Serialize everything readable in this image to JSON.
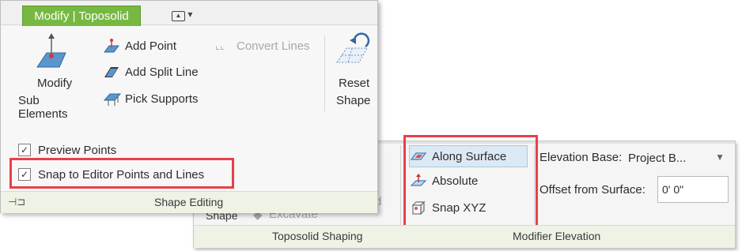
{
  "front_panel": {
    "context_tab": "Modify | Toposolid",
    "qat_toggle": "▾",
    "modify_sub_elements": [
      "Modify",
      "Sub Elements"
    ],
    "add_point": "Add Point",
    "add_split_line": "Add Split Line",
    "pick_supports": "Pick Supports",
    "convert_lines": "Convert Lines",
    "reset_shape": [
      "Reset",
      "Shape"
    ],
    "preview_points": {
      "label": "Preview Points",
      "checked": true
    },
    "snap_to_editor": {
      "label": "Snap to Editor Points and Lines",
      "checked": true
    },
    "panel_title": "Shape Editing",
    "pin_icon": "pin-icon"
  },
  "back_panel": {
    "modifier_items": [
      {
        "label": "Along Surface",
        "selected": true,
        "icon": "along-surface-icon"
      },
      {
        "label": "Absolute",
        "selected": false,
        "icon": "absolute-icon"
      },
      {
        "label": "Snap XYZ",
        "selected": false,
        "icon": "snap-xyz-icon"
      }
    ],
    "elevation_base_label": "Elevation Base:",
    "elevation_base_value": "Project B...",
    "offset_label": "Offset from Surface:",
    "offset_value": "0'  0\"",
    "partial_shape_label": "Shape",
    "partial_excavate_label": "Excavate",
    "partial_solid_label": "olid",
    "toposolid_shaping_title": "Toposolid Shaping",
    "modifier_elevation_title": "Modifier Elevation"
  },
  "colors": {
    "context_tab": "#77b842",
    "highlight": "#e8404a",
    "footer": "#eef3e6",
    "selected_item": "#dbe9f5"
  }
}
